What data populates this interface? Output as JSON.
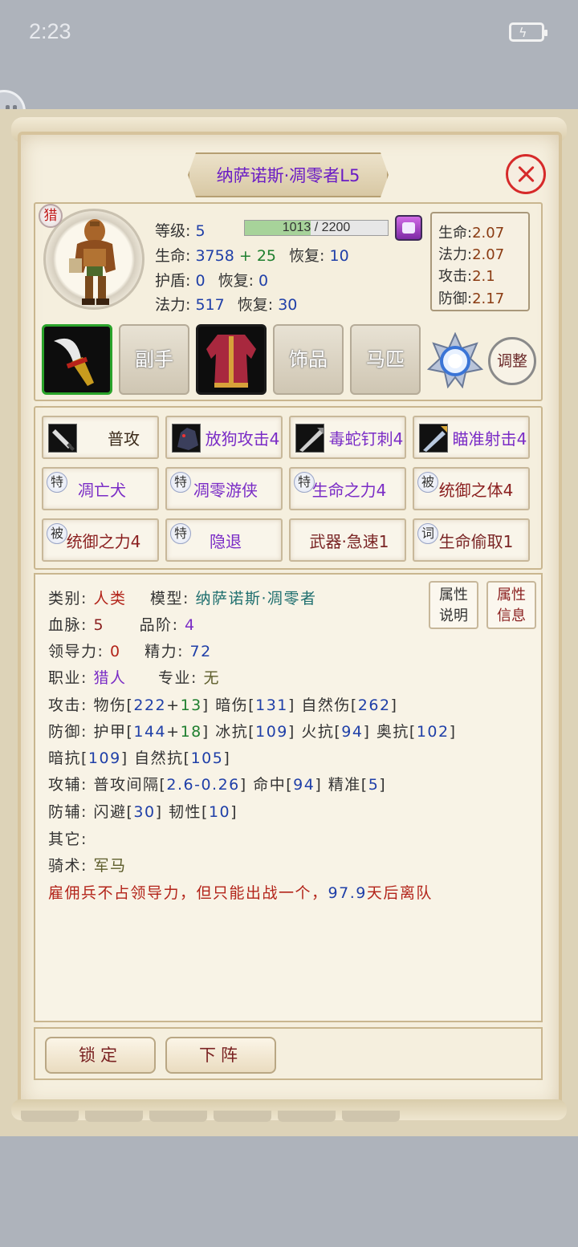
{
  "status_bar": {
    "time": "2:23"
  },
  "hero": {
    "title": "纳萨诺斯·凋零者L5",
    "class_badge": "猎",
    "level_label": "等级:",
    "level": "5",
    "xp_text": "1013 / 2200",
    "xp_progress": 0.46,
    "hp_label": "生命:",
    "hp": "3758",
    "hp_plus": "+ 25",
    "hp_regen_label": "恢复:",
    "hp_regen": "10",
    "shield_label": "护盾:",
    "shield": "0",
    "shield_regen_label": "恢复:",
    "shield_regen": "0",
    "mana_label": "法力:",
    "mana": "517",
    "mana_regen_label": "恢复:",
    "mana_regen": "30"
  },
  "growth": [
    {
      "label": "生命:",
      "value": "2.07"
    },
    {
      "label": "法力:",
      "value": "2.07"
    },
    {
      "label": "攻击:",
      "value": "2.1"
    },
    {
      "label": "防御:",
      "value": "2.17"
    }
  ],
  "equipment": {
    "offhand": "副手",
    "accessory": "饰品",
    "horse": "马匹",
    "adjust": "调整"
  },
  "skills": [
    {
      "badge": "",
      "label": "普攻"
    },
    {
      "badge": "",
      "label": "放狗攻击4"
    },
    {
      "badge": "",
      "label": "毒蛇钉刺4"
    },
    {
      "badge": "",
      "label": "瞄准射击4"
    },
    {
      "badge": "特",
      "label": "凋亡犬"
    },
    {
      "badge": "特",
      "label": "凋零游侠"
    },
    {
      "badge": "特",
      "label": "生命之力4"
    },
    {
      "badge": "被",
      "label": "统御之体4"
    },
    {
      "badge": "被",
      "label": "统御之力4"
    },
    {
      "badge": "特",
      "label": "隐退"
    },
    {
      "badge": "",
      "label": "武器·急速1"
    },
    {
      "badge": "词",
      "label": "生命偷取1"
    }
  ],
  "info": {
    "category_label": "类别:",
    "category": "人类",
    "model_label": "模型:",
    "model": "纳萨诺斯·凋零者",
    "bloodline_label": "血脉:",
    "bloodline": "5",
    "grade_label": "品阶:",
    "grade": "4",
    "leadership_label": "领导力:",
    "leadership": "0",
    "energy_label": "精力:",
    "energy": "72",
    "job_label": "职业:",
    "job": "猎人",
    "specialty_label": "专业:",
    "specialty": "无",
    "attack_label": "攻击:",
    "phys_label": "物伤[",
    "phys_base": "222",
    "phys_plus": "+",
    "phys_bonus": "13",
    "dark_label": "] 暗伤[",
    "dark": "131",
    "nature_label": "] 自然伤[",
    "nature": "262",
    "close": "]",
    "defense_label": "防御:",
    "armor_label": "护甲[",
    "armor_base": "144",
    "armor_plus": "+",
    "armor_bonus": "18",
    "frost_label": "] 冰抗[",
    "frost": "109",
    "fire_label": "] 火抗[",
    "fire": "94",
    "arcane_label": "] 奥抗[",
    "arcane": "102",
    "shadow_res_label": "暗抗[",
    "shadow_res": "109",
    "nature_res_label": "] 自然抗[",
    "nature_res": "105",
    "atk_aux_label": "攻辅:",
    "interval_label": "普攻间隔[",
    "interval": "2.6-0.26",
    "hit_label": "] 命中[",
    "hit": "94",
    "precision_label": "] 精准[",
    "precision": "5",
    "def_aux_label": "防辅:",
    "dodge_label": "闪避[",
    "dodge": "30",
    "tenacity_label": "] 韧性[",
    "tenacity": "10",
    "other_label": "其它:",
    "riding_label": "骑术:",
    "riding": "军马",
    "mercenary_note_a": "雇佣兵不占领导力，但只能出战一个，",
    "mercenary_days": "97.9",
    "mercenary_note_b": "天后离队"
  },
  "buttons": {
    "attr_explain": [
      "属性",
      "说明"
    ],
    "attr_info": [
      "属性",
      "信息"
    ],
    "lock": "锁定",
    "dismiss": "下阵"
  }
}
